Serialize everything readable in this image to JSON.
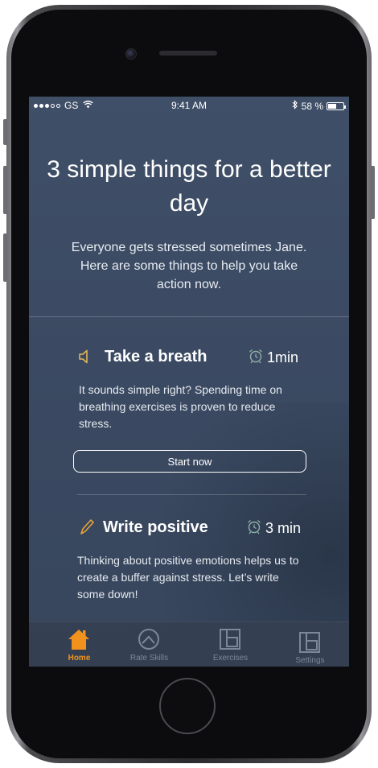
{
  "status_bar": {
    "carrier": "GS",
    "time": "9:41 AM",
    "battery_percent": "58 %",
    "battery_level": 0.58,
    "icons": [
      "signal-dots-icon",
      "wifi-icon",
      "bluetooth-icon",
      "battery-icon"
    ]
  },
  "header": {
    "title": "3 simple things for a better day",
    "subtitle": "Everyone gets stressed sometimes Jane. Here are some things to help you take action now."
  },
  "cards": [
    {
      "icon": "speaker-icon",
      "title": "Take a breath",
      "duration": "1min",
      "description": "It sounds simple right? Spending time on breathing exercises is proven to reduce stress.",
      "button_label": "Start now"
    },
    {
      "icon": "pen-icon",
      "title": "Write positive",
      "duration": "3 min",
      "description": "Thinking about positive emotions helps us to create a buffer against stress. Let’s write some down!"
    }
  ],
  "tabbar": {
    "active": "Home",
    "tabs": [
      {
        "label": "Home",
        "icon": "home-icon"
      },
      {
        "label": "Rate Skills",
        "icon": "clock-icon"
      },
      {
        "label": "Exercises",
        "icon": "exercises-icon"
      },
      {
        "label": "Settings",
        "icon": "settings-icon"
      }
    ]
  },
  "colors": {
    "background": "#3c4b63",
    "accent": "#f2921d",
    "alarm_icon": "#8fb0a8",
    "speaker_icon": "#e0b45a",
    "pen_icon": "#e8a33a"
  }
}
